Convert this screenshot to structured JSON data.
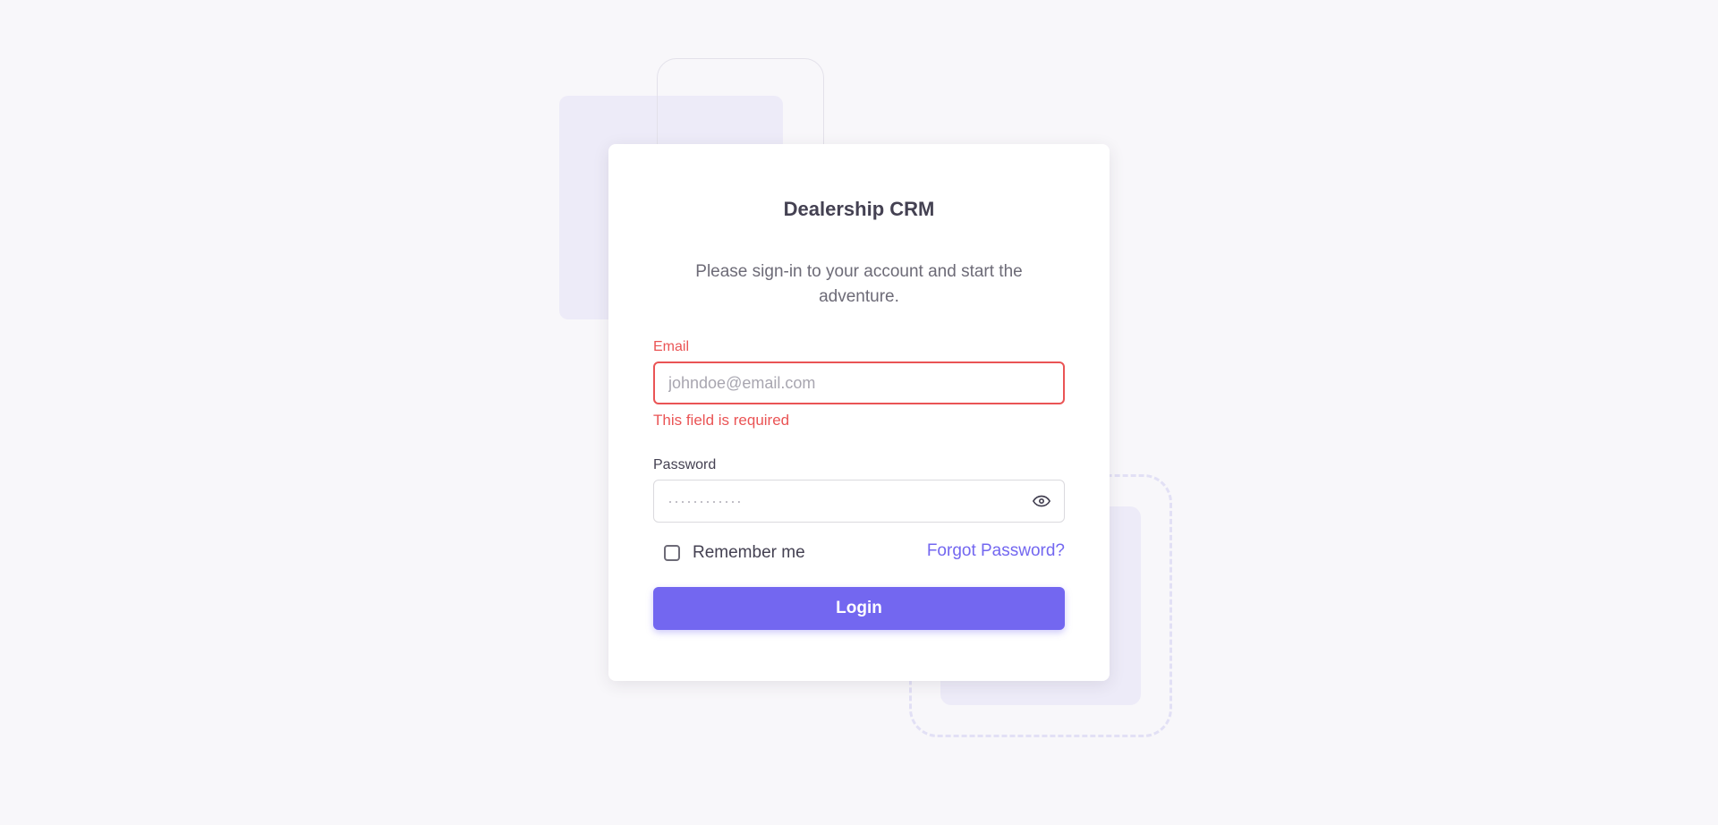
{
  "app": {
    "title": "Dealership CRM",
    "subtitle": "Please sign-in to your account and start the adventure."
  },
  "form": {
    "email": {
      "label": "Email",
      "placeholder": "johndoe@email.com",
      "value": "",
      "error": "This field is required"
    },
    "password": {
      "label": "Password",
      "placeholder": "············",
      "value": "",
      "toggle_icon": "eye-icon"
    },
    "remember_label": "Remember me",
    "remember_checked": false,
    "forgot_label": "Forgot Password?",
    "submit_label": "Login"
  },
  "colors": {
    "primary": "#7367f0",
    "error": "#ea5455",
    "background": "#f8f7fa",
    "heading": "#444152",
    "muted": "#6d6b77"
  }
}
